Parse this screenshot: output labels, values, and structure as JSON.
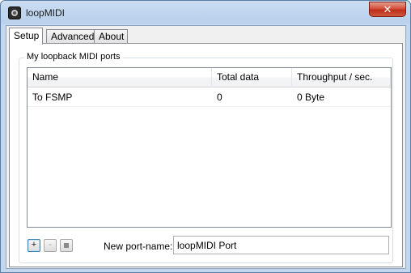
{
  "window": {
    "title": "loopMIDI",
    "close_glyph": "✕",
    "app_icon": "loopmidi-knob-icon"
  },
  "tabs": [
    {
      "label": "Setup",
      "active": true
    },
    {
      "label": "Advanced",
      "active": false
    },
    {
      "label": "About",
      "active": false
    }
  ],
  "group": {
    "legend": "My loopback MIDI ports"
  },
  "table": {
    "columns": [
      "Name",
      "Total data",
      "Throughput / sec."
    ],
    "rows": [
      {
        "name": "To FSMP",
        "total": "0",
        "throughput": "0 Byte"
      }
    ]
  },
  "controls": {
    "add_label": "+",
    "remove_label": "-",
    "stop_icon": "stop-square-icon",
    "port_name_label": "New port-name:",
    "port_name_value": "loopMIDI Port"
  },
  "colors": {
    "close_button": "#c7402a",
    "frame": "#b9d1ec",
    "focus_border": "#3c7fb1"
  }
}
